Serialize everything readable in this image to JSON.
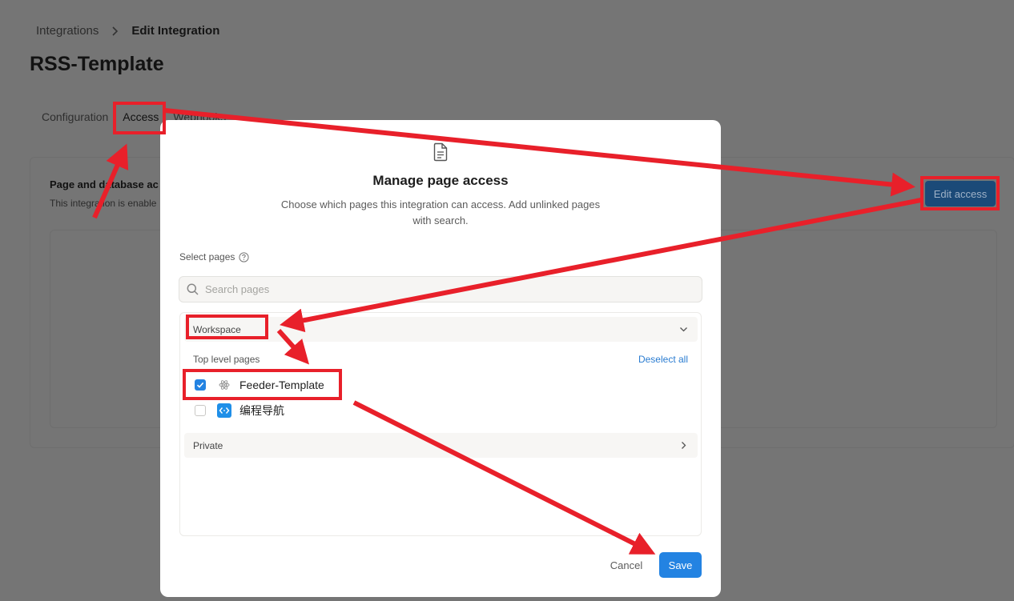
{
  "breadcrumb": {
    "parent": "Integrations",
    "current": "Edit Integration"
  },
  "page": {
    "title": "RSS-Template",
    "tabs": [
      "Configuration",
      "Access",
      "Webhooks"
    ],
    "section_title": "Page and database ac",
    "section_desc": "This integration is enable",
    "edit_access_label": "Edit access"
  },
  "modal": {
    "title": "Manage page access",
    "description": "Choose which pages this integration can access. Add unlinked pages with search.",
    "select_label": "Select pages",
    "search_placeholder": "Search pages",
    "workspace": {
      "label": "Workspace",
      "sub_label": "Top level pages",
      "deselect_label": "Deselect all",
      "pages": [
        {
          "name": "Feeder-Template",
          "checked": true
        },
        {
          "name": "编程导航",
          "checked": false
        }
      ]
    },
    "private_label": "Private",
    "cancel_label": "Cancel",
    "save_label": "Save"
  },
  "colors": {
    "accent": "#2383e2",
    "annotation": "#e8202a",
    "overlay": "#757575"
  }
}
